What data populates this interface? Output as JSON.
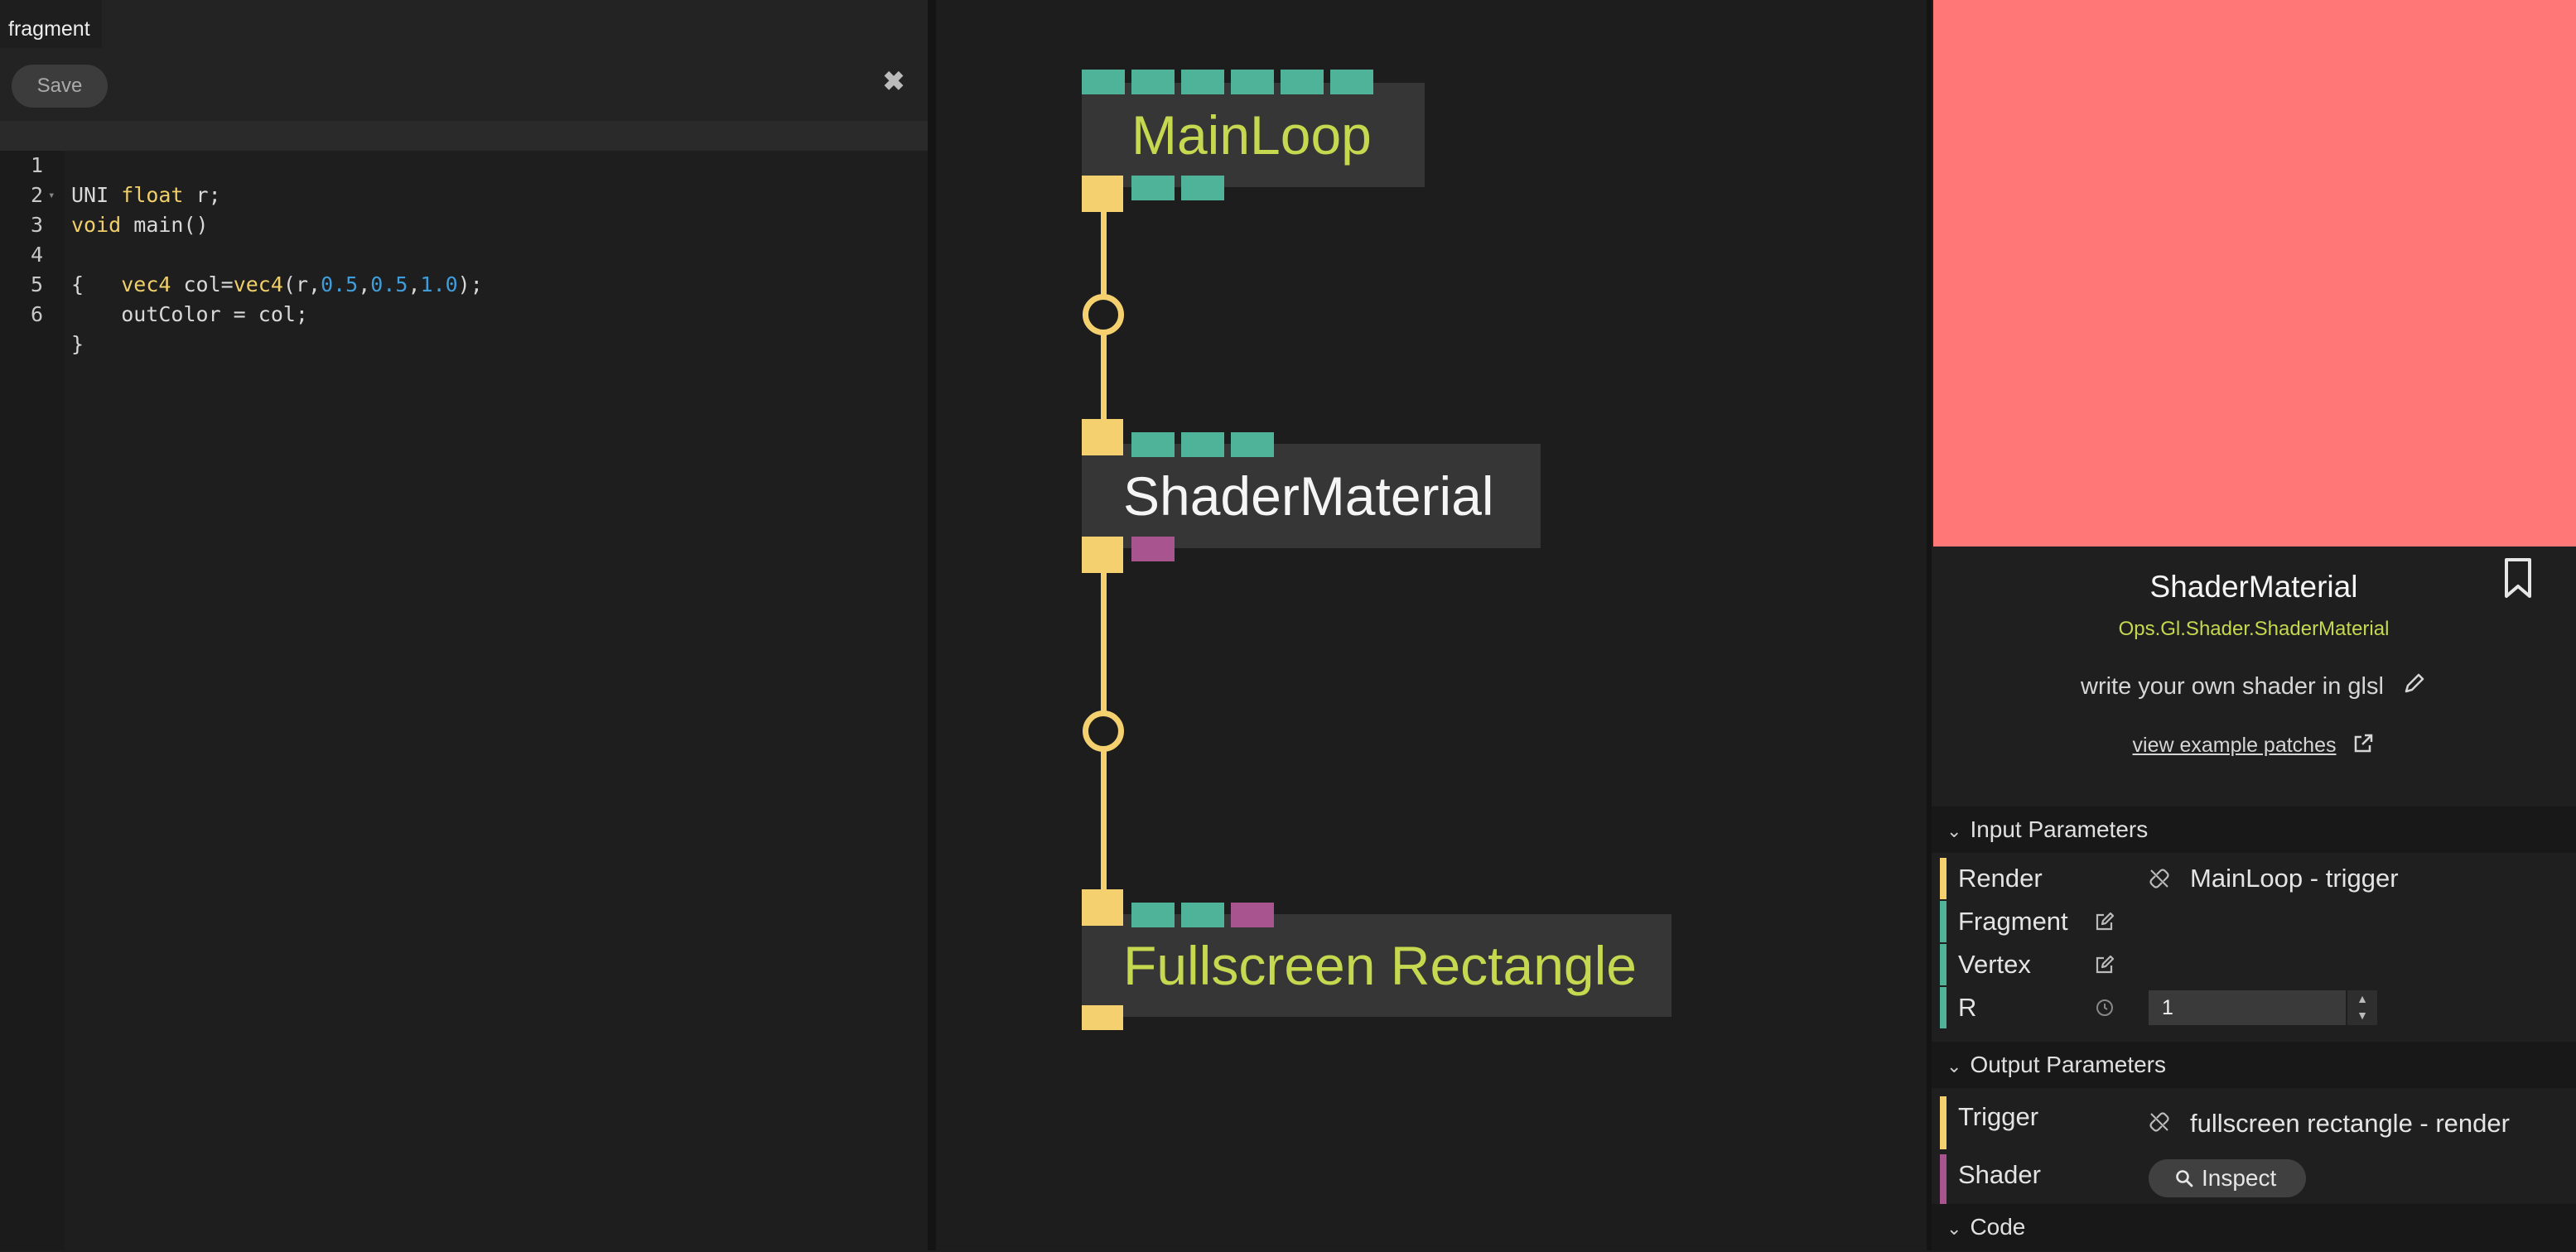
{
  "editor": {
    "tab_label": "fragment",
    "save_label": "Save",
    "close_glyph": "✖",
    "lines": [
      {
        "num": "1"
      },
      {
        "num": "2"
      },
      {
        "num": "3"
      },
      {
        "num": "4"
      },
      {
        "num": "5"
      },
      {
        "num": "6"
      }
    ],
    "code": {
      "l1a": "UNI ",
      "l1b": "float",
      "l1c": " r;",
      "l2a": "void",
      "l2b": " main()",
      "l3a": "{",
      "l4a": "    ",
      "l4b": "vec4",
      "l4c": " col=",
      "l4d": "vec4",
      "l4e": "(r,",
      "l4f": "0.5",
      "l4g": ",",
      "l4h": "0.5",
      "l4i": ",",
      "l4j": "1.0",
      "l4k": ");",
      "l5a": "    outColor = col;",
      "l6a": "}"
    }
  },
  "canvas": {
    "ops": [
      {
        "title": "MainLoop",
        "color": "#c5d84f"
      },
      {
        "title": "ShaderMaterial",
        "color": "#f5f5f5"
      },
      {
        "title": "Fullscreen Rectangle",
        "color": "#c5d84f"
      }
    ],
    "colors": {
      "trigger_port": "#f4d06f",
      "value_port": "#4fb39a",
      "object_port": "#a8548f",
      "preview": "#ff7777"
    }
  },
  "panel": {
    "op_name": "ShaderMaterial",
    "op_path": "Ops.Gl.Shader.ShaderMaterial",
    "op_description": "write your own shader in glsl",
    "example_link": "view example patches",
    "input_header": "Input Parameters",
    "output_header": "Output Parameters",
    "code_header": "Code",
    "inputs": [
      {
        "name": "Render",
        "value": "MainLoop - trigger"
      },
      {
        "name": "Fragment"
      },
      {
        "name": "Vertex"
      },
      {
        "name": "R",
        "value": "1"
      }
    ],
    "outputs": [
      {
        "name": "Trigger",
        "value": "fullscreen rectangle - render"
      },
      {
        "name": "Shader",
        "button": "Inspect"
      }
    ]
  }
}
